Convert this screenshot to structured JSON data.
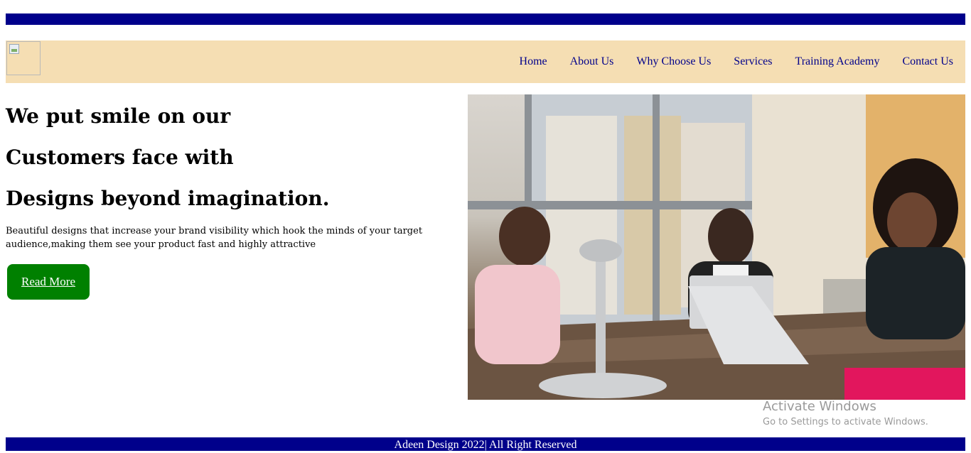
{
  "nav": {
    "links": [
      "Home",
      "About Us",
      "Why Choose Us",
      "Services",
      "Training Academy",
      "Contact Us"
    ]
  },
  "hero": {
    "heading_lines": [
      "We put smile on our",
      "Customers face with",
      "Designs beyond imagination."
    ],
    "description": "Beautiful designs that increase your brand visibility which hook the minds of your target audience,making them see your product fast and highly attractive",
    "button_label": "Read More"
  },
  "watermark": {
    "title": "Activate Windows",
    "subtitle": "Go to Settings to activate Windows."
  },
  "footer": {
    "text": "Adeen Design 2022| All Right Reserved"
  },
  "colors": {
    "bar": "#00008b",
    "navbar": "#f5deb3",
    "button": "#008000"
  }
}
